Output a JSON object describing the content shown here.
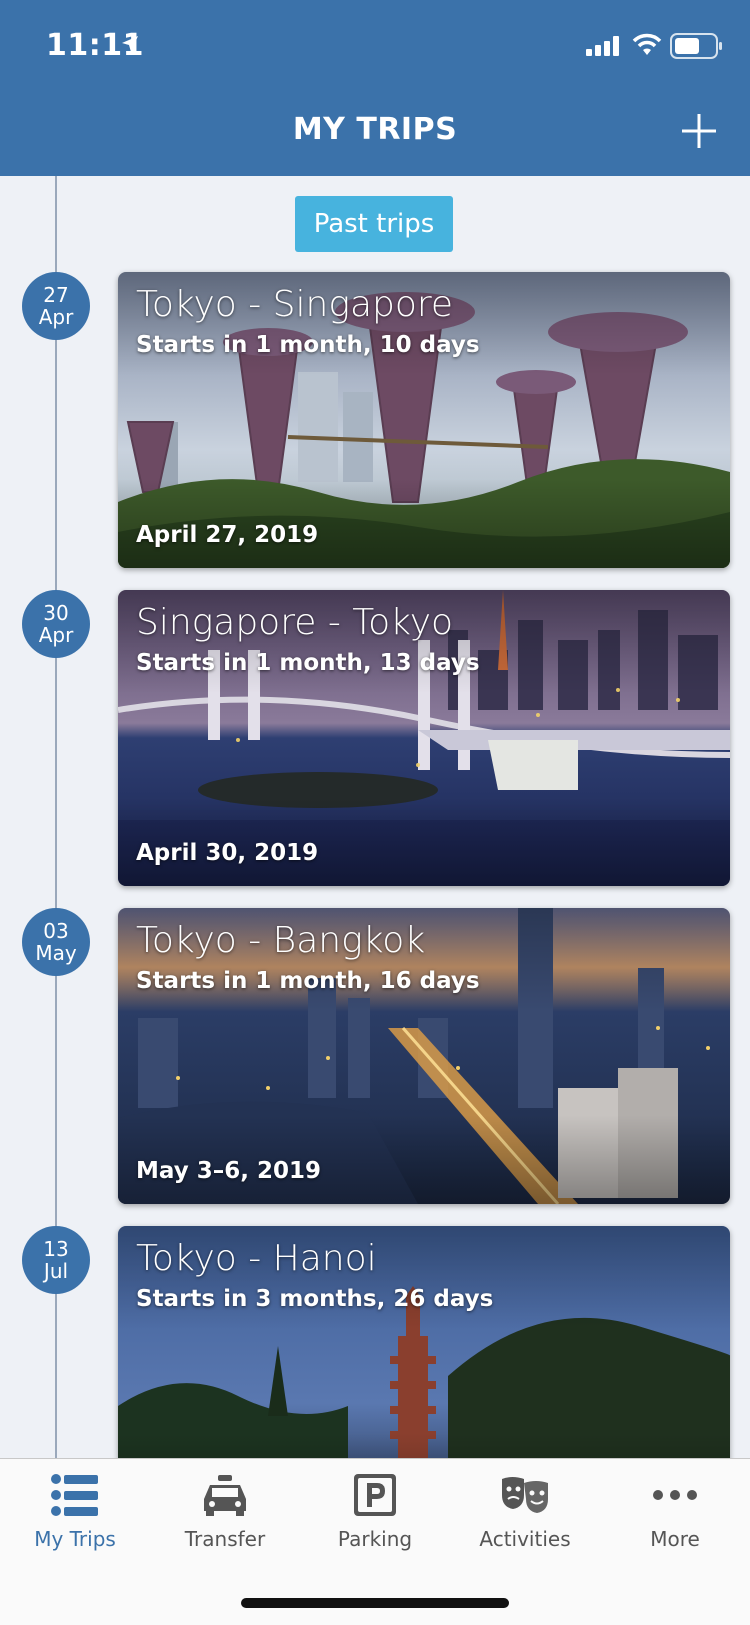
{
  "status_bar": {
    "time": "11:11"
  },
  "header": {
    "title": "MY TRIPS"
  },
  "past_trips_label": "Past trips",
  "trips": [
    {
      "badge_day": "27",
      "badge_month": "Apr",
      "title": "Tokyo - Singapore",
      "starts_in": "Starts in 1 month, 10 days",
      "date": "April 27, 2019"
    },
    {
      "badge_day": "30",
      "badge_month": "Apr",
      "title": "Singapore - Tokyo",
      "starts_in": "Starts in 1 month, 13 days",
      "date": "April 30, 2019"
    },
    {
      "badge_day": "03",
      "badge_month": "May",
      "title": "Tokyo - Bangkok",
      "starts_in": "Starts in 1 month, 16 days",
      "date": "May 3–6, 2019"
    },
    {
      "badge_day": "13",
      "badge_month": "Jul",
      "title": "Tokyo - Hanoi",
      "starts_in": "Starts in 3 months, 26 days",
      "date": ""
    }
  ],
  "tabbar": {
    "items": [
      {
        "label": "My Trips",
        "icon": "list-icon",
        "active": true
      },
      {
        "label": "Transfer",
        "icon": "car-icon",
        "active": false
      },
      {
        "label": "Parking",
        "icon": "parking-icon",
        "active": false
      },
      {
        "label": "Activities",
        "icon": "theater-masks-icon",
        "active": false
      },
      {
        "label": "More",
        "icon": "more-dots-icon",
        "active": false
      }
    ]
  },
  "colors": {
    "header": "#3b72aa",
    "accent": "#47b3de",
    "active_tab": "#3b72aa"
  }
}
